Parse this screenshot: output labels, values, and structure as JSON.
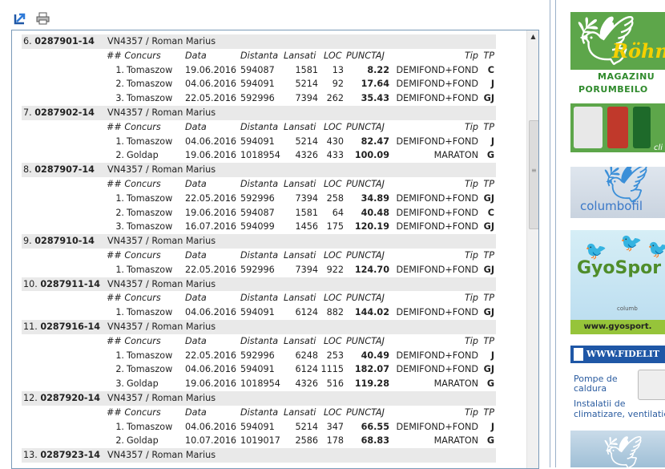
{
  "toolbar": {
    "export_icon": "export-arrow-icon",
    "print_icon": "printer-icon"
  },
  "table": {
    "header": {
      "nr": "##",
      "concurs": "Concurs",
      "data": "Data",
      "distanta": "Distanta",
      "lansati": "Lansati",
      "loc": "LOC",
      "punctaj": "PUNCTAJ",
      "tip": "Tip",
      "tp": "TP"
    },
    "pigeons": [
      {
        "index": "6.",
        "ring": "0287901-14",
        "owner": "VN4357 / Roman Marius",
        "results": [
          {
            "nr": "1.",
            "concurs": "Tomaszow",
            "data": "19.06.2016",
            "distanta": "594087",
            "lansati": "1581",
            "loc": "13",
            "punctaj": "8.22",
            "tip": "DEMIFOND+FOND",
            "tp": "C"
          },
          {
            "nr": "2.",
            "concurs": "Tomaszow",
            "data": "04.06.2016",
            "distanta": "594091",
            "lansati": "5214",
            "loc": "92",
            "punctaj": "17.64",
            "tip": "DEMIFOND+FOND",
            "tp": "J"
          },
          {
            "nr": "3.",
            "concurs": "Tomaszow",
            "data": "22.05.2016",
            "distanta": "592996",
            "lansati": "7394",
            "loc": "262",
            "punctaj": "35.43",
            "tip": "DEMIFOND+FOND",
            "tp": "GJ"
          }
        ]
      },
      {
        "index": "7.",
        "ring": "0287902-14",
        "owner": "VN4357 / Roman Marius",
        "results": [
          {
            "nr": "1.",
            "concurs": "Tomaszow",
            "data": "04.06.2016",
            "distanta": "594091",
            "lansati": "5214",
            "loc": "430",
            "punctaj": "82.47",
            "tip": "DEMIFOND+FOND",
            "tp": "J"
          },
          {
            "nr": "2.",
            "concurs": "Goldap",
            "data": "19.06.2016",
            "distanta": "1018954",
            "lansati": "4326",
            "loc": "433",
            "punctaj": "100.09",
            "tip": "MARATON",
            "tp": "G"
          }
        ]
      },
      {
        "index": "8.",
        "ring": "0287907-14",
        "owner": "VN4357 / Roman Marius",
        "results": [
          {
            "nr": "1.",
            "concurs": "Tomaszow",
            "data": "22.05.2016",
            "distanta": "592996",
            "lansati": "7394",
            "loc": "258",
            "punctaj": "34.89",
            "tip": "DEMIFOND+FOND",
            "tp": "GJ"
          },
          {
            "nr": "2.",
            "concurs": "Tomaszow",
            "data": "19.06.2016",
            "distanta": "594087",
            "lansati": "1581",
            "loc": "64",
            "punctaj": "40.48",
            "tip": "DEMIFOND+FOND",
            "tp": "C"
          },
          {
            "nr": "3.",
            "concurs": "Tomaszow",
            "data": "16.07.2016",
            "distanta": "594099",
            "lansati": "1456",
            "loc": "175",
            "punctaj": "120.19",
            "tip": "DEMIFOND+FOND",
            "tp": "GJ"
          }
        ]
      },
      {
        "index": "9.",
        "ring": "0287910-14",
        "owner": "VN4357 / Roman Marius",
        "results": [
          {
            "nr": "1.",
            "concurs": "Tomaszow",
            "data": "22.05.2016",
            "distanta": "592996",
            "lansati": "7394",
            "loc": "922",
            "punctaj": "124.70",
            "tip": "DEMIFOND+FOND",
            "tp": "GJ"
          }
        ]
      },
      {
        "index": "10.",
        "ring": "0287911-14",
        "owner": "VN4357 / Roman Marius",
        "results": [
          {
            "nr": "1.",
            "concurs": "Tomaszow",
            "data": "04.06.2016",
            "distanta": "594091",
            "lansati": "6124",
            "loc": "882",
            "punctaj": "144.02",
            "tip": "DEMIFOND+FOND",
            "tp": "GJ"
          }
        ]
      },
      {
        "index": "11.",
        "ring": "0287916-14",
        "owner": "VN4357 / Roman Marius",
        "results": [
          {
            "nr": "1.",
            "concurs": "Tomaszow",
            "data": "22.05.2016",
            "distanta": "592996",
            "lansati": "6248",
            "loc": "253",
            "punctaj": "40.49",
            "tip": "DEMIFOND+FOND",
            "tp": "J"
          },
          {
            "nr": "2.",
            "concurs": "Tomaszow",
            "data": "04.06.2016",
            "distanta": "594091",
            "lansati": "6124",
            "loc": "1115",
            "punctaj": "182.07",
            "tip": "DEMIFOND+FOND",
            "tp": "GJ"
          },
          {
            "nr": "3.",
            "concurs": "Goldap",
            "data": "19.06.2016",
            "distanta": "1018954",
            "lansati": "4326",
            "loc": "516",
            "punctaj": "119.28",
            "tip": "MARATON",
            "tp": "G"
          }
        ]
      },
      {
        "index": "12.",
        "ring": "0287920-14",
        "owner": "VN4357 / Roman Marius",
        "results": [
          {
            "nr": "1.",
            "concurs": "Tomaszow",
            "data": "04.06.2016",
            "distanta": "594091",
            "lansati": "5214",
            "loc": "347",
            "punctaj": "66.55",
            "tip": "DEMIFOND+FOND",
            "tp": "J"
          },
          {
            "nr": "2.",
            "concurs": "Goldap",
            "data": "10.07.2016",
            "distanta": "1019017",
            "lansati": "2586",
            "loc": "178",
            "punctaj": "68.83",
            "tip": "MARATON",
            "tp": "G"
          }
        ]
      },
      {
        "index": "13.",
        "ring": "0287923-14",
        "owner": "VN4357 / Roman Marius",
        "results": []
      }
    ]
  },
  "ads": {
    "rohnfried": {
      "brand": "Röhnfr",
      "line1": "MAGAZINU",
      "line2": "PORUMBEILO",
      "suffix": "cli"
    },
    "columbofil": {
      "text": "columbofil"
    },
    "gyosport": {
      "text": "GyoSpor",
      "sub": "columb",
      "url": "www.gyosport."
    },
    "fidelitas": {
      "brand": "WWW.FIDELIT",
      "line1": "Pompe de caldura",
      "line2": "Instalatii de climatizare, ventilatie"
    }
  },
  "colors": {
    "panel_border": "#7a9ab8",
    "row_head_bg": "#e9e9e9",
    "ad_green": "#5da64a",
    "ad_blue": "#1f57a6"
  }
}
